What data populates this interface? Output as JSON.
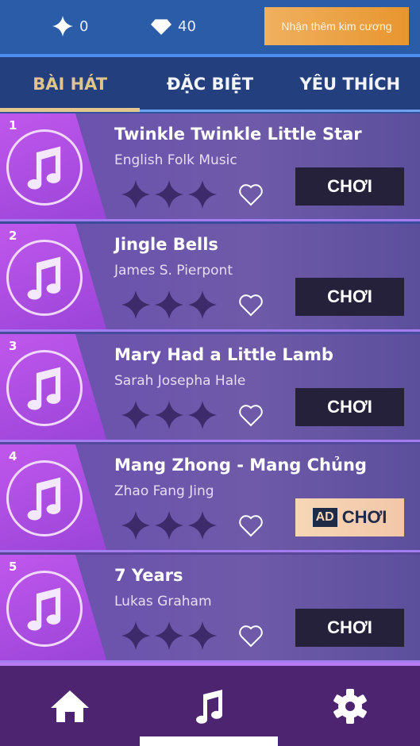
{
  "header": {
    "stars": "0",
    "diamonds": "40",
    "get_diamonds_label": "Nhận thêm kim cương"
  },
  "tabs": [
    {
      "label": "BÀI HÁT",
      "active": true
    },
    {
      "label": "ĐẶC BIỆT"
    },
    {
      "label": "YÊU THÍCH"
    }
  ],
  "songs": [
    {
      "index": "1",
      "title": "Twinkle Twinkle Little Star",
      "artist": "English Folk Music",
      "stars_earned": 0,
      "play_label": "CHƠI",
      "ad": false
    },
    {
      "index": "2",
      "title": "Jingle Bells",
      "artist": "James S. Pierpont",
      "stars_earned": 0,
      "play_label": "CHƠI",
      "ad": false
    },
    {
      "index": "3",
      "title": "Mary Had a Little Lamb",
      "artist": "Sarah Josepha Hale",
      "stars_earned": 0,
      "play_label": "CHƠI",
      "ad": false
    },
    {
      "index": "4",
      "title": "Mang Zhong - Mang Chủng",
      "artist": "Zhao Fang Jing",
      "stars_earned": 0,
      "play_label": "CHƠI",
      "ad": true,
      "ad_label": "AD"
    },
    {
      "index": "5",
      "title": "7 Years",
      "artist": "Lukas Graham",
      "stars_earned": 0,
      "play_label": "CHƠI",
      "ad": false
    }
  ],
  "nav": [
    {
      "icon": "home-icon"
    },
    {
      "icon": "music-note-icon",
      "active": true
    },
    {
      "icon": "gear-icon"
    }
  ]
}
